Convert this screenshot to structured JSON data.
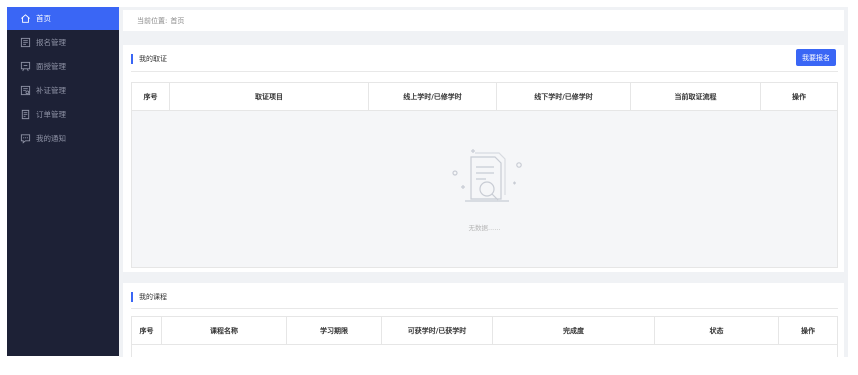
{
  "sidebar": {
    "items": [
      {
        "label": "首页",
        "icon": "home-icon",
        "active": true
      },
      {
        "label": "报名管理",
        "icon": "registration-icon"
      },
      {
        "label": "面授管理",
        "icon": "classroom-icon"
      },
      {
        "label": "补证管理",
        "icon": "certificate-icon"
      },
      {
        "label": "订单管理",
        "icon": "order-icon"
      },
      {
        "label": "我的通知",
        "icon": "message-icon"
      }
    ]
  },
  "breadcrumb": {
    "prefix": "当前位置:",
    "current": "首页"
  },
  "certificates": {
    "title": "我的取证",
    "action_label": "我要报名",
    "columns": [
      "序号",
      "取证项目",
      "线上学时/已修学时",
      "线下学时/已修学时",
      "当前取证流程",
      "操作"
    ],
    "empty_text": "无数据......"
  },
  "courses": {
    "title": "我的课程",
    "columns": [
      "序号",
      "课程名称",
      "学习期限",
      "可获学时/已获学时",
      "完成度",
      "状态",
      "操作"
    ]
  },
  "colors": {
    "sidebar_bg": "#1d2136",
    "accent": "#3a66f5"
  }
}
